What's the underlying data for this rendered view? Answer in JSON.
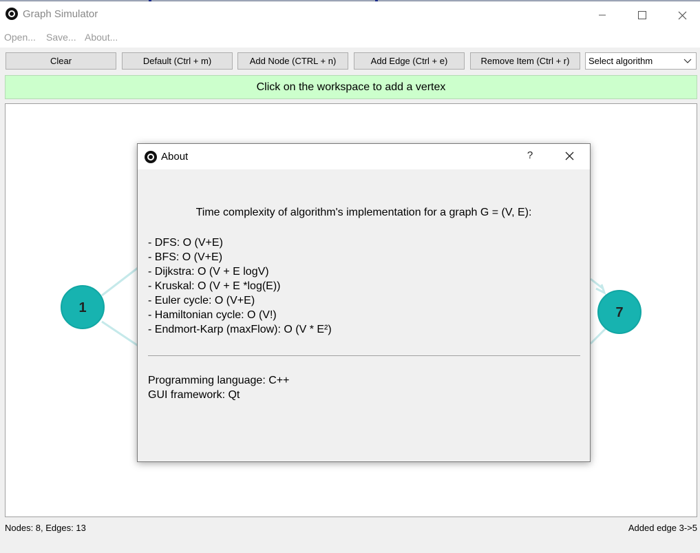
{
  "window": {
    "title": "Graph Simulator",
    "minimize_icon": "minimize-icon",
    "maximize_icon": "maximize-icon",
    "close_icon": "close-icon"
  },
  "menu": {
    "open": "Open...",
    "save": "Save...",
    "about": "About..."
  },
  "toolbar": {
    "clear": "Clear",
    "default": "Default (Ctrl + m)",
    "add_node": "Add Node (CTRL + n)",
    "add_edge": "Add Edge (Ctrl + e)",
    "remove_item": "Remove Item (Ctrl + r)",
    "algorithm_select": "Select algorithm"
  },
  "hint": "Click on the workspace to add a vertex",
  "graph": {
    "node_color": "#17b3b0",
    "edge_color": "#c5e9ea",
    "nodes": [
      {
        "id": "1",
        "label": "1"
      },
      {
        "id": "7",
        "label": "7"
      }
    ]
  },
  "status": {
    "left": "Nodes: 8, Edges: 13",
    "right": "Added edge 3->5"
  },
  "dialog": {
    "title": "About",
    "help": "?",
    "heading": "Time complexity of algorithm's implementation for a graph G = (V, E):",
    "items": [
      "- DFS:  O (V+E)",
      "- BFS:  O (V+E)",
      "- Dijkstra: O (V + E logV)",
      "- Kruskal: O (V + E *log(E))",
      "- Euler cycle: O (V+E)",
      "- Hamiltonian cycle: O (V!)",
      "- Endmort-Karp (maxFlow): O (V * E²)"
    ],
    "language": "Programming language: C++",
    "framework": "GUI framework: Qt"
  }
}
